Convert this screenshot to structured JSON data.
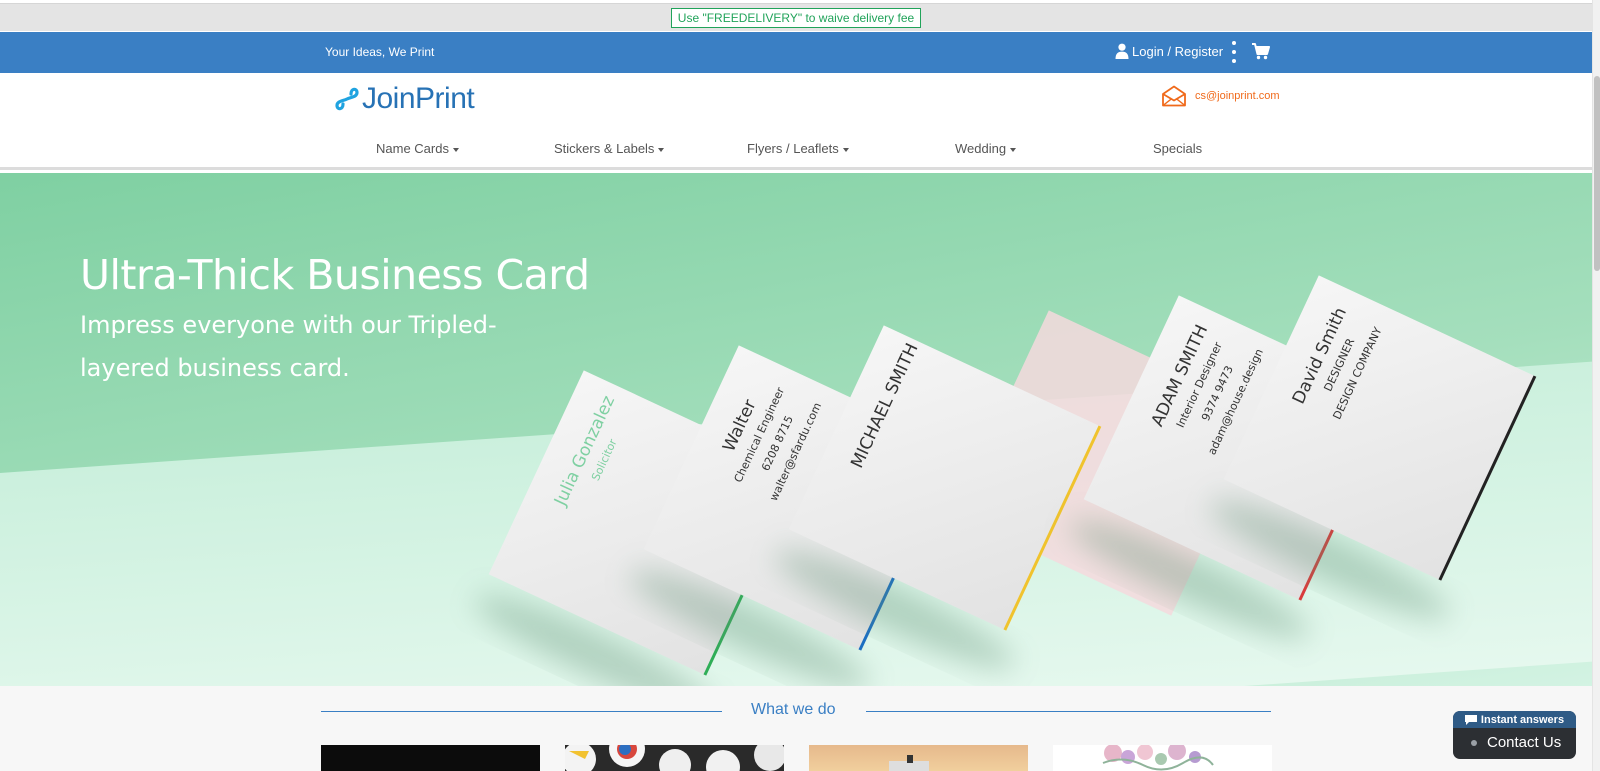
{
  "promo": {
    "text": "Use \"FREEDELIVERY\" to waive delivery fee"
  },
  "top_bar": {
    "tagline": "Your Ideas, We Print",
    "login_label": "Login / Register"
  },
  "brand": {
    "logo_text": "JoinPrint",
    "email": "cs@joinprint.com"
  },
  "nav": {
    "items": [
      {
        "label": "Name Cards",
        "has_dropdown": true
      },
      {
        "label": "Stickers & Labels",
        "has_dropdown": true
      },
      {
        "label": "Flyers / Leaflets",
        "has_dropdown": true
      },
      {
        "label": "Wedding",
        "has_dropdown": true
      },
      {
        "label": "Specials",
        "has_dropdown": false
      }
    ]
  },
  "hero": {
    "title": "Ultra-Thick Business Card",
    "subtitle": "Impress everyone with our Tripled-layered business card.",
    "cards": [
      {
        "name": "Julia Gonzalez",
        "role": "Solicitor",
        "edge_color": "#2fae57"
      },
      {
        "name": "Walter",
        "role": "Chemical Engineer",
        "phone": "6208 8715",
        "email": "walter@sfardu.com",
        "edge_color": "#1c6fc1"
      },
      {
        "name": "MICHAEL SMITH",
        "edge_color": "#f0c32d"
      },
      {
        "name": "ADAM SMITH",
        "role": "Interior Designer",
        "phone": "9374 9473",
        "email": "adam@house.design",
        "edge_color": "#d83c3c"
      },
      {
        "name": "David Smith",
        "role": "DESIGNER",
        "company": "DESIGN COMPANY",
        "edge_color": "#222222"
      }
    ]
  },
  "section": {
    "title": "What we do"
  },
  "chat": {
    "header": "Instant answers",
    "contact_label": "Contact Us"
  },
  "colors": {
    "brand_blue": "#3a7fc4",
    "promo_green": "#21a35a",
    "email_orange": "#f06a1b"
  }
}
